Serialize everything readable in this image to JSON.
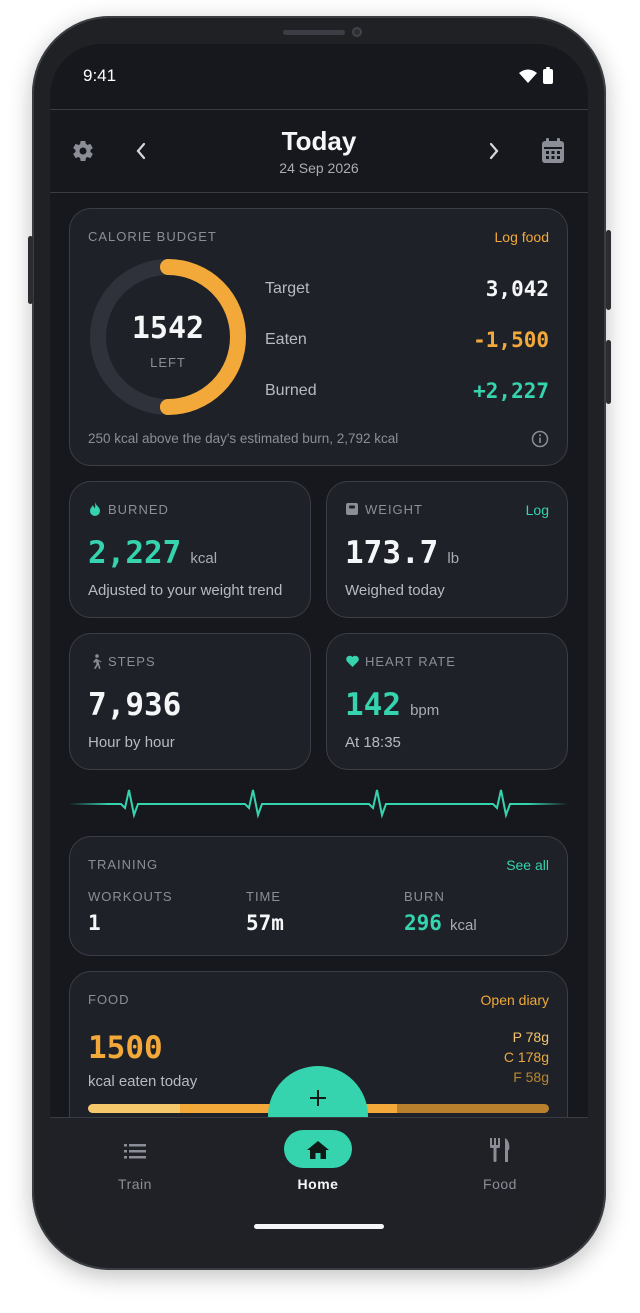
{
  "status_bar": {
    "time": "9:41"
  },
  "header": {
    "title": "Today",
    "date": "24 Sep 2026"
  },
  "calorie_budget": {
    "label": "CALORIE BUDGET",
    "action": "Log food",
    "remaining": "1542",
    "remaining_caption": "LEFT",
    "ring_fraction": 0.5,
    "rows": [
      {
        "label": "Target",
        "value": "3,042"
      },
      {
        "label": "Eaten",
        "value": "-1,500"
      },
      {
        "label": "Burned",
        "value": "+2,227"
      }
    ],
    "note": "250 kcal above the day's estimated burn, 2,792 kcal"
  },
  "burned_card": {
    "label": "BURNED",
    "value": "2,227",
    "unit": "kcal",
    "caption": "Adjusted to your weight trend"
  },
  "weight_card": {
    "label": "WEIGHT",
    "action": "Log",
    "value": "173.7",
    "unit": "lb",
    "caption": "Weighed today"
  },
  "steps_card": {
    "label": "STEPS",
    "value": "7,936",
    "caption": "Hour by hour"
  },
  "heart_card": {
    "label": "HEART RATE",
    "value": "142",
    "unit": "bpm",
    "caption": "At 18:35"
  },
  "training": {
    "label": "TRAINING",
    "action": "See all",
    "stats": [
      {
        "label": "WORKOUTS",
        "value": "1",
        "unit": ""
      },
      {
        "label": "TIME",
        "value": "57m",
        "unit": ""
      },
      {
        "label": "BURN",
        "value": "296",
        "unit": "kcal"
      }
    ]
  },
  "food": {
    "label": "FOOD",
    "action": "Open diary",
    "value": "1500",
    "caption": "kcal eaten today",
    "macros": {
      "protein": "P 78g",
      "carbs": "C 178g",
      "fat": "F 58g"
    }
  },
  "bottom_nav": {
    "items": [
      {
        "label": "Train"
      },
      {
        "label": "Home"
      },
      {
        "label": "Food"
      }
    ]
  },
  "colors": {
    "accent_teal": "#35d3ae",
    "accent_orange": "#f2a93a",
    "background": "#17181d",
    "card": "#1f2128"
  }
}
